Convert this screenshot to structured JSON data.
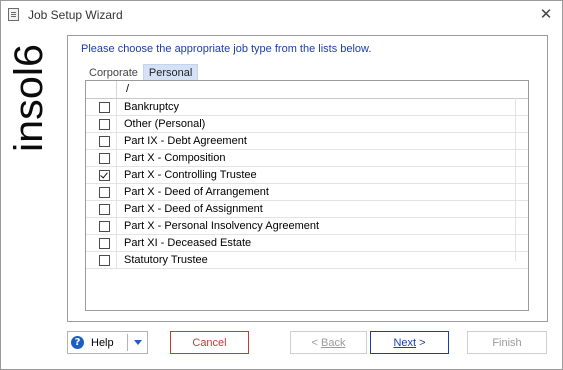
{
  "window": {
    "title": "Job Setup Wizard",
    "close_glyph": "✕"
  },
  "logo": {
    "text": "insol6",
    "color": "#0b0b0b"
  },
  "instruction": "Please choose the appropriate job type from the lists below.",
  "tabs": [
    {
      "label": "Corporate",
      "active": false
    },
    {
      "label": "Personal",
      "active": true
    }
  ],
  "grid": {
    "header": "/",
    "rows": [
      {
        "label": "Bankruptcy",
        "checked": false
      },
      {
        "label": "Other (Personal)",
        "checked": false
      },
      {
        "label": "Part IX - Debt Agreement",
        "checked": false
      },
      {
        "label": "Part X - Composition",
        "checked": false
      },
      {
        "label": "Part X - Controlling Trustee",
        "checked": true
      },
      {
        "label": "Part X - Deed of Arrangement",
        "checked": false
      },
      {
        "label": "Part X - Deed of Assignment",
        "checked": false
      },
      {
        "label": "Part X - Personal Insolvency Agreement",
        "checked": false
      },
      {
        "label": "Part XI - Deceased Estate",
        "checked": false
      },
      {
        "label": "Statutory Trustee",
        "checked": false
      }
    ]
  },
  "buttons": {
    "help": "Help",
    "help_icon": "?",
    "cancel": "Cancel",
    "back_arrow": "<",
    "back": "Back",
    "next": "Next",
    "next_arrow": ">",
    "finish": "Finish"
  },
  "colors": {
    "accent_blue": "#1a3ea8",
    "cancel_red": "#c43a3a",
    "active_tab_bg": "#d4e1f7"
  }
}
